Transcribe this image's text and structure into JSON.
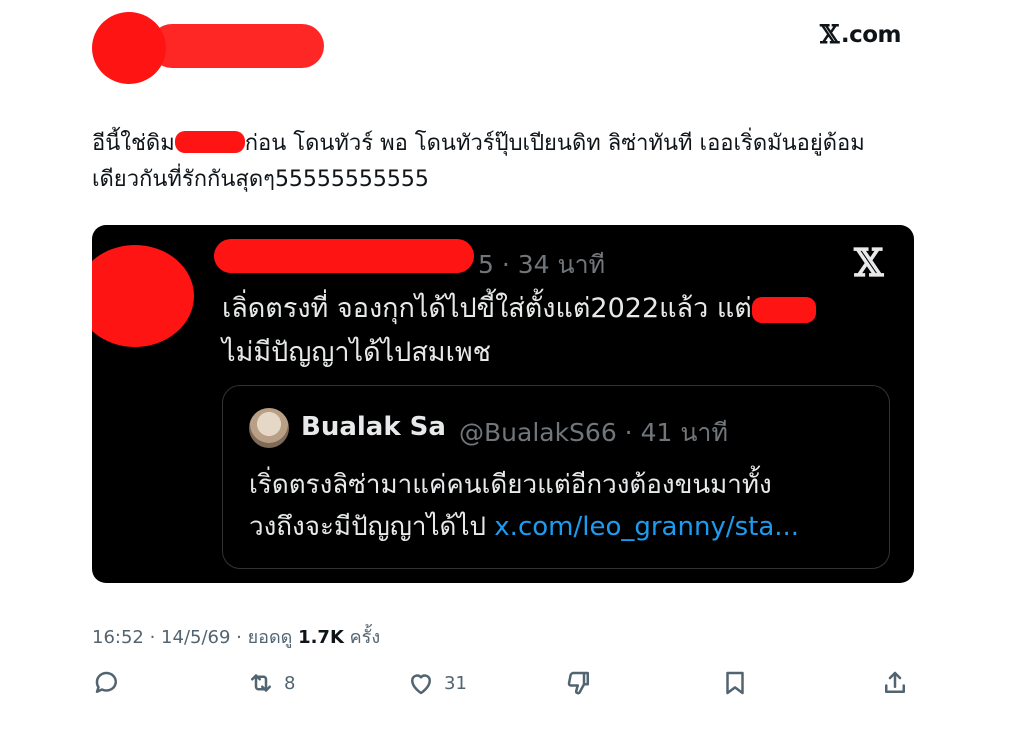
{
  "header": {
    "brand_text": ".com"
  },
  "tweet": {
    "text_part1": "อีนี้ใช่ดิม",
    "text_part2": "ก่อน โดนทัวร์ พอ โดนทัวร์ปุ๊บเปียนดิท ลิซ่าทันที เออเริ่ดมันอยู่ด้อม\nเดียวกันที่รักกันสุดๆ55555555555"
  },
  "embed": {
    "meta": "5 · 34 นาที",
    "text_part1": "เลิ่ดตรงที่ จองกุกได้ไปขี้ใส่ตั้งแต่2022แล้ว แต่",
    "text_part2": "\nไม่มีปัญญาได้ไปสมเพช",
    "quote": {
      "name": "Bualak Sa",
      "handle": "@BualakS66 · 41 นาที",
      "text": "เริ่ดตรงลิซ่ามาแค่คนเดียวแต่อีกวงต้องขนมาทั้ง\nวงถึงจะมีปัญญาได้ไป ",
      "link": "x.com/leo_granny/sta..."
    }
  },
  "meta": {
    "time_date": "16:52 · 14/5/69 · ยอดดู ",
    "views": "1.7K",
    "views_suffix": " ครั้ง"
  },
  "actions": {
    "reply_count": "",
    "retweet_count": "8",
    "like_count": "31"
  },
  "colors": {
    "redaction": "#ff1414",
    "link": "#1d9bf0",
    "dark_bg": "#000000",
    "muted": "#536471"
  }
}
